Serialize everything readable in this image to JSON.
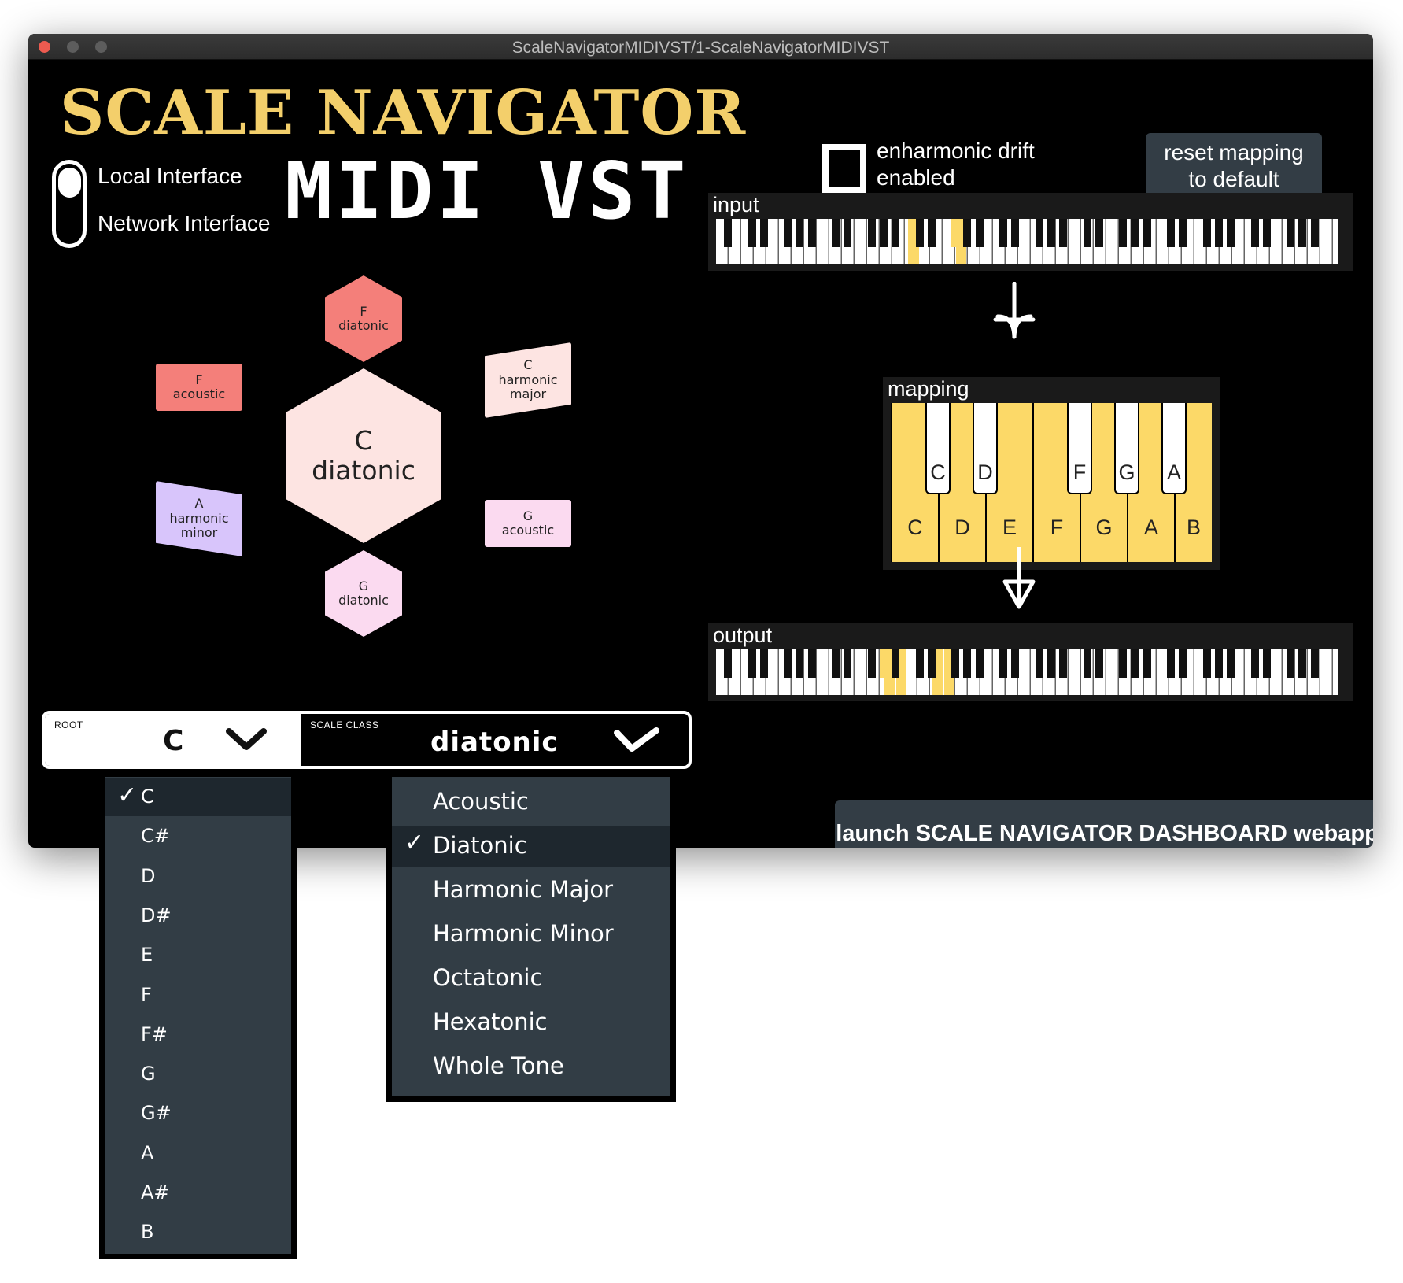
{
  "window": {
    "title": "ScaleNavigatorMIDIVST/1-ScaleNavigatorMIDIVST"
  },
  "logo": {
    "line1": "SCALE NAVIGATOR",
    "line2": "MIDI VST"
  },
  "interface_toggle": {
    "option_top": "Local Interface",
    "option_bottom": "Network Interface",
    "selected": "Local Interface"
  },
  "scale_graph": {
    "center": {
      "root": "C",
      "class": "diatonic",
      "color": "#fde4e2"
    },
    "neighbors": [
      {
        "root": "F",
        "class": "diatonic",
        "color": "#f47f7a"
      },
      {
        "root": "F",
        "class": "acoustic",
        "color": "#f47f7a"
      },
      {
        "root": "C",
        "class": "harmonic major",
        "color": "#fde4e2"
      },
      {
        "root": "A",
        "class": "harmonic minor",
        "color": "#d8c5fb"
      },
      {
        "root": "G",
        "class": "acoustic",
        "color": "#fbdaf0"
      },
      {
        "root": "G",
        "class": "diatonic",
        "color": "#fbdaf0"
      }
    ]
  },
  "enharmonic": {
    "label_line1": "enharmonic drift",
    "label_line2": "enabled",
    "checked": false
  },
  "reset_button": {
    "line1": "reset mapping",
    "line2": "to default"
  },
  "input_keyboard": {
    "label": "input",
    "highlight_color": "#fcd968"
  },
  "mapping": {
    "label": "mapping",
    "white_keys": [
      "C",
      "D",
      "E",
      "F",
      "G",
      "A",
      "B"
    ],
    "black_keys": [
      "C",
      "D",
      "F",
      "G",
      "A"
    ],
    "color": "#fcd968"
  },
  "output_keyboard": {
    "label": "output"
  },
  "selector": {
    "root_label": "ROOT",
    "root_value": "C",
    "scale_label": "SCALE CLASS",
    "scale_value": "diatonic"
  },
  "launch_button": {
    "label": "launch SCALE NAVIGATOR DASHBOARD webapp"
  },
  "root_dropdown": {
    "selected": "C",
    "options": [
      "C",
      "C#",
      "D",
      "D#",
      "E",
      "F",
      "F#",
      "G",
      "G#",
      "A",
      "A#",
      "B"
    ]
  },
  "scale_dropdown": {
    "selected": "Diatonic",
    "options": [
      "Acoustic",
      "Diatonic",
      "Harmonic Major",
      "Harmonic Minor",
      "Octatonic",
      "Hexatonic",
      "Whole Tone"
    ]
  },
  "icons": {
    "checkmark": "✓",
    "chevron": "chevron-down",
    "arrow": "down-arrow"
  }
}
